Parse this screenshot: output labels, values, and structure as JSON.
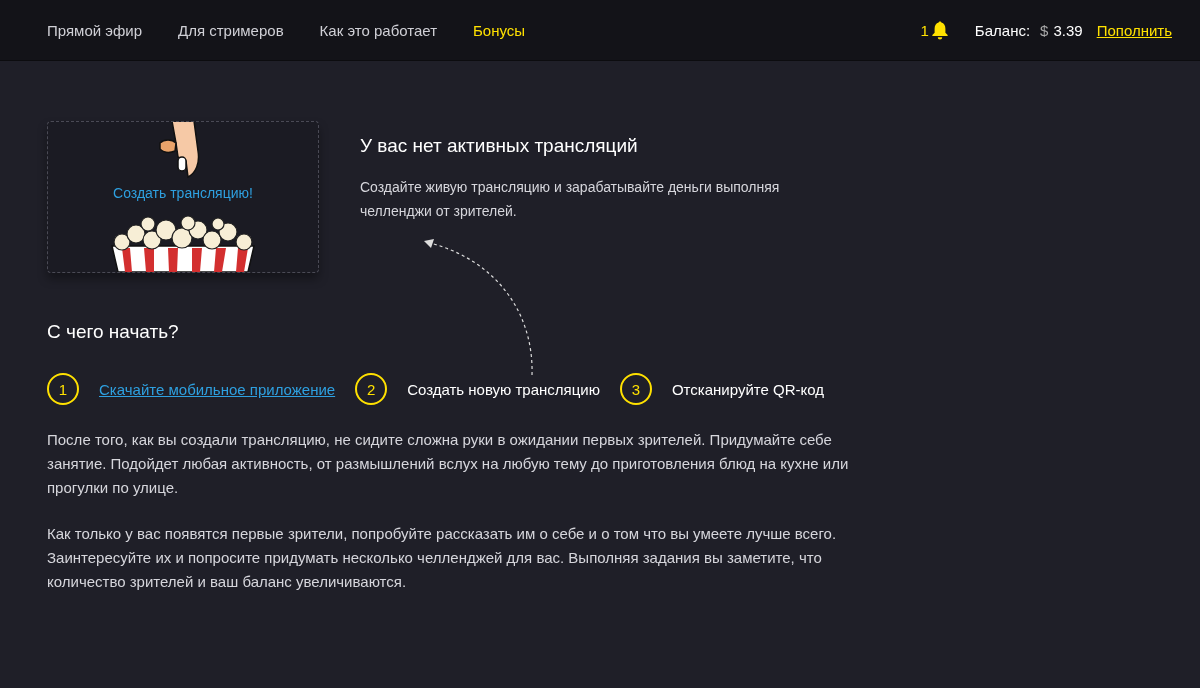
{
  "nav": [
    {
      "label": "Прямой эфир",
      "selected": false
    },
    {
      "label": "Для стримеров",
      "selected": false
    },
    {
      "label": "Как это работает",
      "selected": false
    },
    {
      "label": "Бонусы",
      "selected": true
    }
  ],
  "notifications": {
    "count": "1"
  },
  "balance": {
    "label": "Баланс:",
    "currency": "$",
    "amount": "3.39",
    "top_up": "Пополнить"
  },
  "create_card": {
    "label": "Создать трансляцию!"
  },
  "empty_state": {
    "title": "У вас нет активных трансляций",
    "text": "Создайте живую трансляцию и зарабатывайте деньги выполняя челленджи от зрителей."
  },
  "getting_started": {
    "title": "С чего начать?",
    "steps": [
      {
        "number": "1",
        "label": "Скачайте мобильное приложение",
        "kind": "link"
      },
      {
        "number": "2",
        "label": "Создать новую трансляцию",
        "kind": "text"
      },
      {
        "number": "3",
        "label": "Отсканируйте QR-код",
        "kind": "text"
      }
    ],
    "paragraphs": [
      "После того, как вы создали трансляцию, не сидите сложна руки в ожидании первых зрителей. Придумайте себе занятие. Подойдет любая активность, от размышлений вслух на любую тему до приготовления блюд на кухне или прогулки по улице.",
      "Как только у вас появятся первые зрители, попробуйте рассказать им о себе и о том что вы умеете лучше всего. Заинтересуйте их и попросите придумать несколько челленджей для вас. Выполняя задания вы заметите, что количество зрителей и ваш баланс увеличиваются."
    ]
  }
}
